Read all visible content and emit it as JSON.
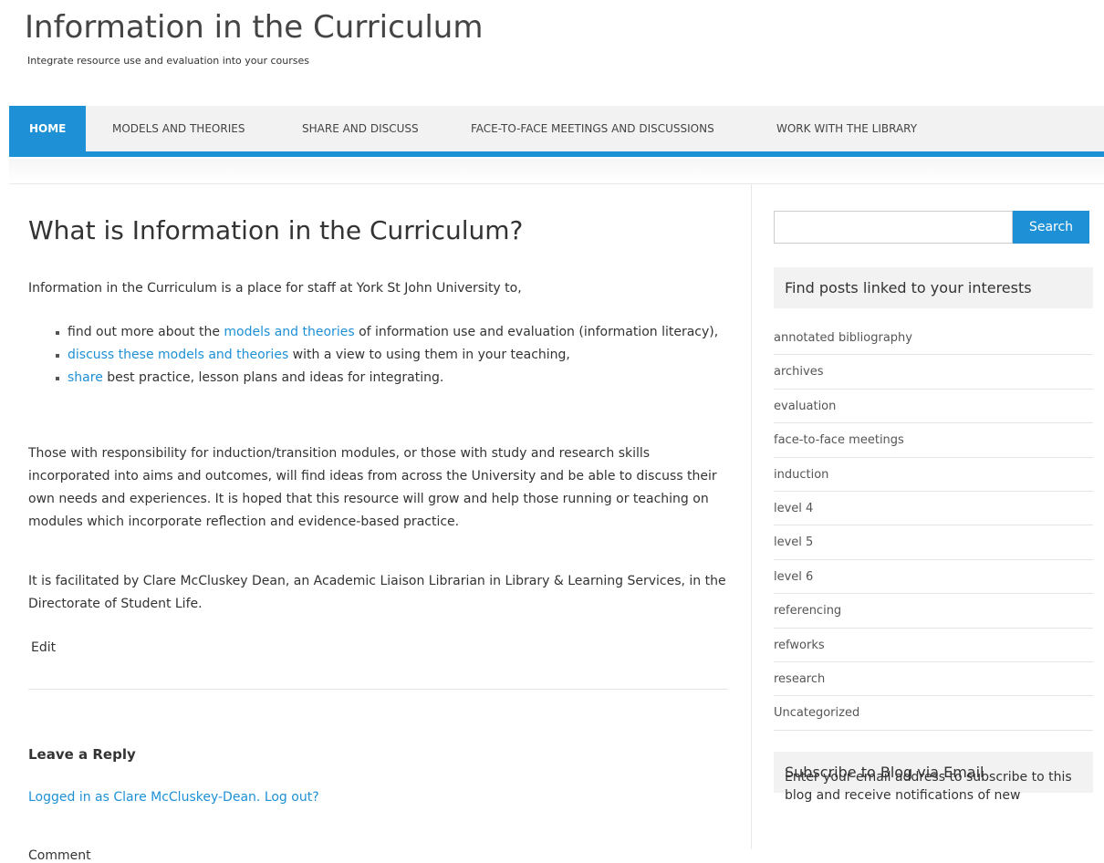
{
  "site": {
    "title": "Information in the Curriculum",
    "tagline": "Integrate resource use and evaluation into your courses"
  },
  "nav": {
    "items": [
      {
        "label": "HOME"
      },
      {
        "label": "MODELS AND THEORIES"
      },
      {
        "label": "SHARE AND DISCUSS"
      },
      {
        "label": "FACE-TO-FACE MEETINGS AND DISCUSSIONS"
      },
      {
        "label": "WORK WITH THE LIBRARY"
      }
    ]
  },
  "main": {
    "title": "What is Information in the Curriculum?",
    "intro": "Information in the Curriculum is a place for staff at York St John University to,",
    "bullets": [
      {
        "pre": "find out more about the ",
        "link": "models and theories",
        "post": " of information use and evaluation (information literacy),"
      },
      {
        "pre": "",
        "link": "discuss these models and theories",
        "post": " with a view to using them in your teaching,"
      },
      {
        "pre": "",
        "link": "share",
        "post": " best practice, lesson plans and ideas for integrating."
      }
    ],
    "para2": "Those with responsibility for induction/transition modules, or those with study and research skills incorporated into aims and outcomes, will find ideas from across the University and be able to discuss their own needs and experiences. It is hoped that this resource will grow and help those running or teaching on modules which incorporate reflection and evidence-based practice.",
    "para3": "It is facilitated by Clare McCluskey Dean, an Academic Liaison Librarian in Library & Learning Services, in the Directorate of Student Life.",
    "edit_label": "Edit",
    "reply_title": "Leave a Reply",
    "logged_in_text": "Logged in as Clare McCluskey-Dean.",
    "logout_text": "Log out?",
    "comment_label": "Comment"
  },
  "sidebar": {
    "search_placeholder": "",
    "search_button": "Search",
    "interests_title": "Find posts linked to your interests",
    "categories": [
      "annotated bibliography",
      "archives",
      "evaluation",
      "face-to-face meetings",
      "induction",
      "level 4",
      "level 5",
      "level 6",
      "referencing",
      "refworks",
      "research",
      "Uncategorized"
    ],
    "subscribe_title": "Subscribe to Blog via Email",
    "subscribe_text": "Enter your email address to subscribe to this blog and receive notifications of new"
  },
  "colors": {
    "accent": "#1e90d6",
    "widget_bg": "#f2f2f2"
  }
}
